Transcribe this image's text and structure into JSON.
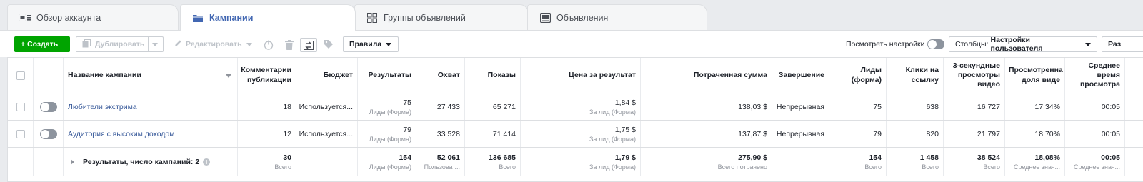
{
  "tabs": [
    {
      "label": "Обзор аккаунта",
      "icon": "account-overview-icon"
    },
    {
      "label": "Кампании",
      "icon": "folder-icon"
    },
    {
      "label": "Группы объявлений",
      "icon": "adsets-grid-icon"
    },
    {
      "label": "Объявления",
      "icon": "ad-icon"
    }
  ],
  "toolbar": {
    "create": "+ Создать",
    "duplicate": "Дублировать",
    "edit": "Редактировать",
    "rules": "Правила",
    "view_settings": "Посмотреть настройки",
    "columns_prefix": "Столбцы:",
    "columns_value": "Настройки пользователя",
    "breakdown": "Раз"
  },
  "table": {
    "headers": {
      "name": "Название кампании",
      "comments": "Комментарии публикации",
      "budget": "Бюджет",
      "results": "Результаты",
      "reach": "Охват",
      "impressions": "Показы",
      "cost_per_result": "Цена за результат",
      "amount_spent": "Потраченная сумма",
      "ends": "Завершение",
      "leads": "Лиды (форма)",
      "link_clicks": "Клики на ссылку",
      "video_3s": "3-секундные просмотры видео",
      "video_pct": "Просмотренна доля виде",
      "avg_watch": "Среднее время просмотра"
    },
    "rows": [
      {
        "name": "Любители экстрима",
        "comments": "18",
        "budget": "Используется...",
        "results": "75",
        "results_sub": "Лиды (Форма)",
        "reach": "27 433",
        "impressions": "65 271",
        "cost": "1,84 $",
        "cost_sub": "За лид (Форма)",
        "spent": "138,03 $",
        "ends": "Непрерывная",
        "leads": "75",
        "link_clicks": "638",
        "video_3s": "16 727",
        "video_pct": "17,34%",
        "avg_watch": "00:05"
      },
      {
        "name": "Аудитория с высоким доходом",
        "comments": "12",
        "budget": "Используется...",
        "results": "79",
        "results_sub": "Лиды (Форма)",
        "reach": "33 528",
        "impressions": "71 414",
        "cost": "1,75 $",
        "cost_sub": "За лид (Форма)",
        "spent": "137,87 $",
        "ends": "Непрерывная",
        "leads": "79",
        "link_clicks": "820",
        "video_3s": "21 797",
        "video_pct": "18,70%",
        "avg_watch": "00:05"
      }
    ],
    "totals": {
      "label": "Результаты, число кампаний: 2",
      "comments": "30",
      "comments_sub": "Всего",
      "results": "154",
      "results_sub": "Лиды (Форма)",
      "reach": "52 061",
      "reach_sub": "Пользоват...",
      "impressions": "136 685",
      "impressions_sub": "Всего",
      "cost": "1,79 $",
      "cost_sub": "За лид (Форма)",
      "spent": "275,90 $",
      "spent_sub": "Всего потрачено",
      "leads": "154",
      "leads_sub": "Всего",
      "link_clicks": "1 458",
      "link_clicks_sub": "Всего",
      "video_3s": "38 524",
      "video_3s_sub": "Всего",
      "video_pct": "18,08%",
      "video_pct_sub": "Среднее знач...",
      "avg_watch": "00:05",
      "avg_watch_sub": "Среднее знач..."
    }
  },
  "colors": {
    "accent": "#4267b2",
    "create_green": "#00a400",
    "link": "#365899"
  }
}
